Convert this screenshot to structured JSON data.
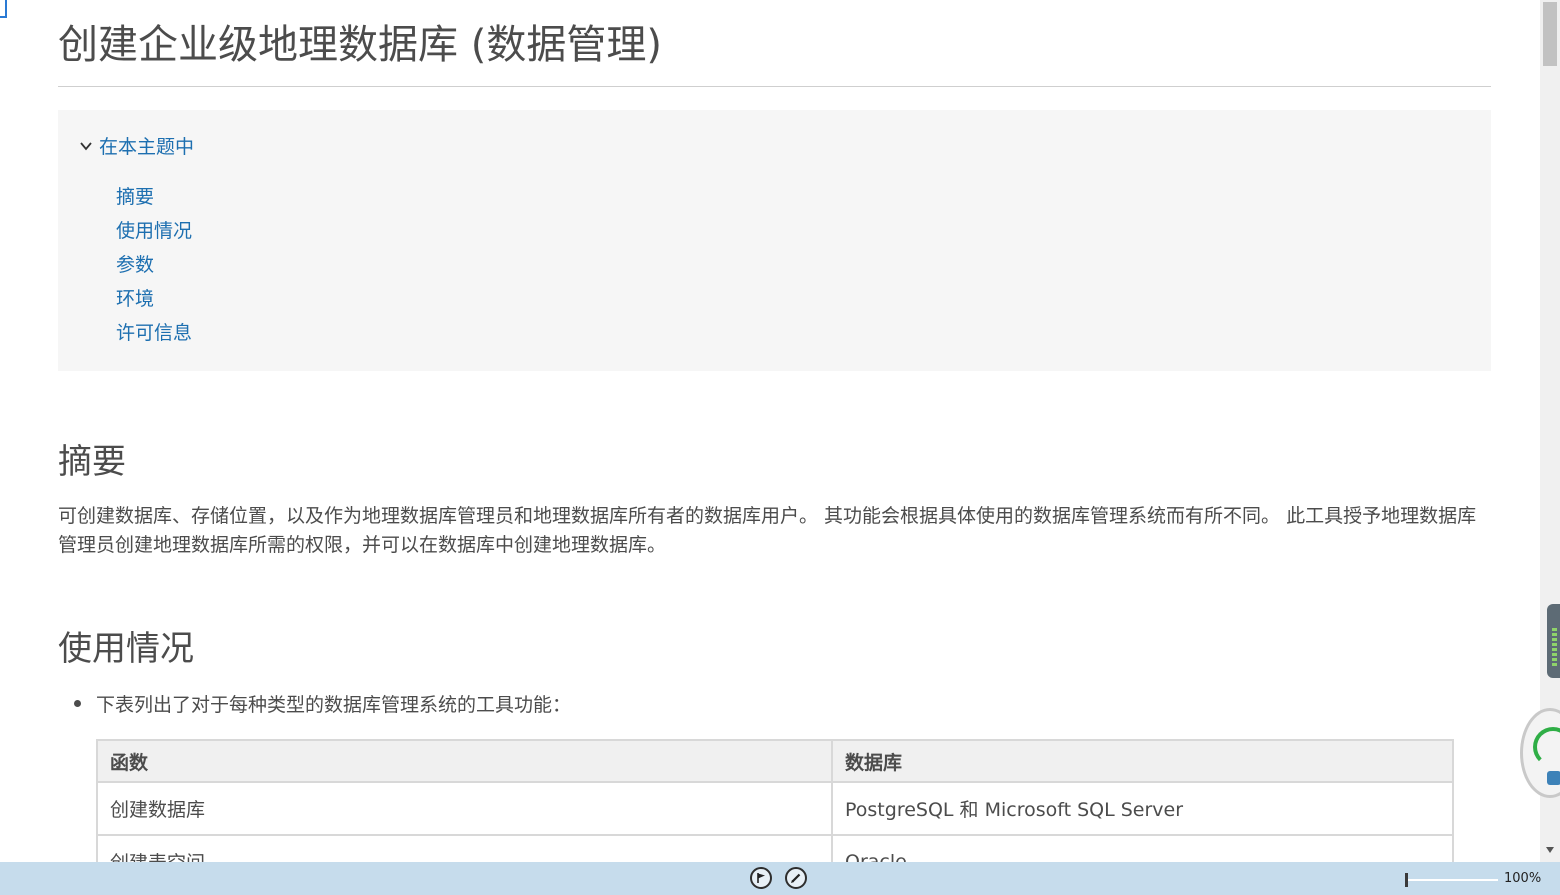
{
  "page": {
    "title": "创建企业级地理数据库 (数据管理)"
  },
  "toc": {
    "header": "在本主题中",
    "items": [
      {
        "label": "摘要"
      },
      {
        "label": "使用情况"
      },
      {
        "label": "参数"
      },
      {
        "label": "环境"
      },
      {
        "label": "许可信息"
      }
    ]
  },
  "summary": {
    "heading": "摘要",
    "text": "可创建数据库、存储位置，以及作为地理数据库管理员和地理数据库所有者的数据库用户。 其功能会根据具体使用的数据库管理系统而有所不同。 此工具授予地理数据库管理员创建地理数据库所需的权限，并可以在数据库中创建地理数据库。"
  },
  "usage": {
    "heading": "使用情况",
    "bullet": "下表列出了对于每种类型的数据库管理系统的工具功能：",
    "table": {
      "headers": [
        "函数",
        "数据库"
      ],
      "rows": [
        [
          "创建数据库",
          "PostgreSQL 和 Microsoft SQL Server"
        ],
        [
          "创建表空间",
          "Oracle"
        ]
      ]
    }
  },
  "statusbar": {
    "zoom": "100%"
  },
  "colors": {
    "link": "#1d6fb0",
    "text": "#4c4c4c",
    "toc_bg": "#f6f6f6",
    "statusbar_bg": "#c6dcec"
  },
  "icons": [
    "chevron-down-icon",
    "flag-icon",
    "edit-icon",
    "scroll-up-icon",
    "scroll-down-icon"
  ]
}
